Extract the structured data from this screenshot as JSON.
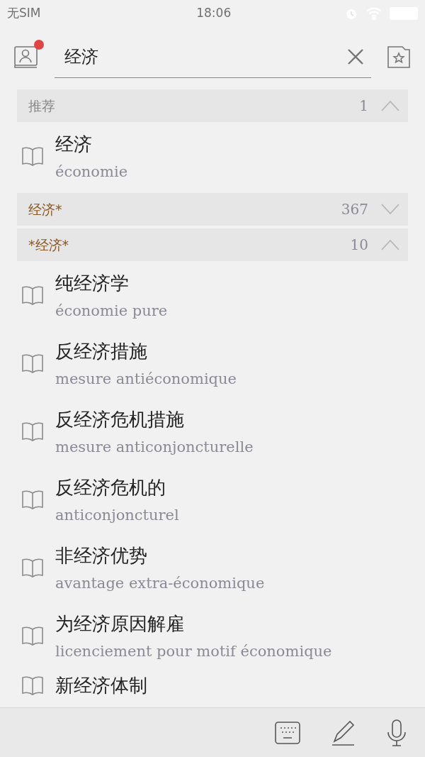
{
  "status_bar": {
    "carrier": "无SIM",
    "time": "18:06"
  },
  "search": {
    "value": "经济",
    "notification": true
  },
  "sections": [
    {
      "title": "推荐",
      "count": "1",
      "expanded": true,
      "highlight": false,
      "entries": [
        {
          "headword": "经济",
          "translation": "économie"
        }
      ]
    },
    {
      "title": "经济*",
      "count": "367",
      "expanded": false,
      "highlight": true
    },
    {
      "title": "*经济*",
      "count": "10",
      "expanded": true,
      "highlight": true,
      "entries": [
        {
          "headword": "纯经济学",
          "translation": "économie pure"
        },
        {
          "headword": "反经济措施",
          "translation": "mesure antiéconomique"
        },
        {
          "headword": "反经济危机措施",
          "translation": "mesure anticonjoncturelle"
        },
        {
          "headword": "反经济危机的",
          "translation": "anticonjoncturel"
        },
        {
          "headword": "非经济优势",
          "translation": "avantage extra-économique"
        },
        {
          "headword": "为经济原因解雇",
          "translation": "licenciement pour motif économique"
        },
        {
          "headword": "新经济体制"
        }
      ]
    }
  ]
}
